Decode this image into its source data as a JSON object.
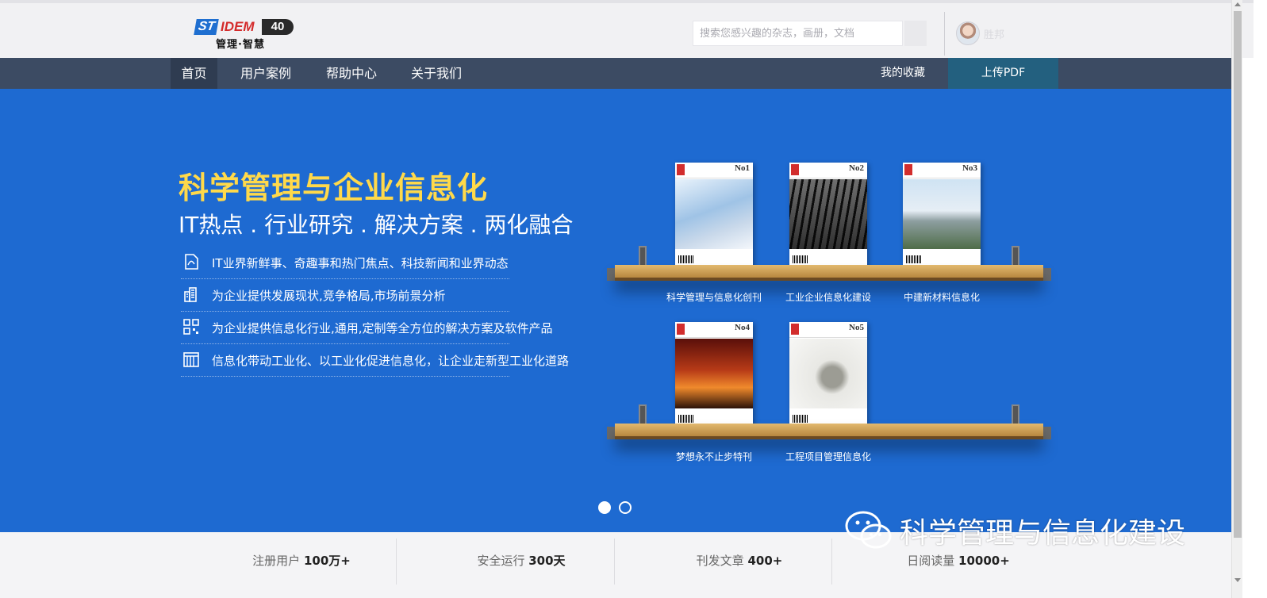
{
  "header": {
    "logo": {
      "part1": "ST",
      "part2": "IDEM",
      "part3": "40",
      "subtitle": "管理·智慧"
    },
    "search_placeholder": "搜索您感兴趣的杂志，画册，文档",
    "username": "胜邦"
  },
  "nav": {
    "items": [
      {
        "label": "首页",
        "active": true
      },
      {
        "label": "用户案例",
        "active": false
      },
      {
        "label": "帮助中心",
        "active": false
      },
      {
        "label": "关于我们",
        "active": false
      }
    ],
    "favorites": "我的收藏",
    "upload": "上传PDF"
  },
  "hero": {
    "title": "科学管理与企业信息化",
    "subtitle": "IT热点 . 行业研究 . 解决方案 . 两化融合",
    "features": [
      {
        "icon": "document-icon",
        "text": "IT业界新鲜事、奇趣事和热门焦点、科技新闻和业界动态"
      },
      {
        "icon": "buildings-icon",
        "text": "为企业提供发展现状,竞争格局,市场前景分析"
      },
      {
        "icon": "qrcode-icon",
        "text": "为企业提供信息化行业,通用,定制等全方位的解决方案及软件产品"
      },
      {
        "icon": "factory-icon",
        "text": "信息化带动工业化、以工业化促进信息化，让企业走新型工业化道路"
      }
    ]
  },
  "shelves": [
    {
      "books": [
        {
          "label": "科学管理与信息化创刊",
          "no": "No1"
        },
        {
          "label": "工业企业信息化建设",
          "no": "No2"
        },
        {
          "label": "中建新材料信息化",
          "no": "No3"
        }
      ]
    },
    {
      "books": [
        {
          "label": "梦想永不止步特刊",
          "no": "No4"
        },
        {
          "label": "工程项目管理信息化",
          "no": "No5"
        }
      ]
    }
  ],
  "carousel": {
    "count": 2,
    "active": 0
  },
  "stats": [
    {
      "label": "注册用户",
      "value": "100万+"
    },
    {
      "label": "安全运行",
      "value": "300天"
    },
    {
      "label": "刊发文章",
      "value": "400+"
    },
    {
      "label": "日阅读量",
      "value": "10000+"
    }
  ],
  "watermark": "科学管理与信息化建设",
  "colors": {
    "banner": "#1e6ad1",
    "nav": "#3c4b63",
    "upload": "#23607f",
    "title_yellow": "#ffd94a"
  }
}
